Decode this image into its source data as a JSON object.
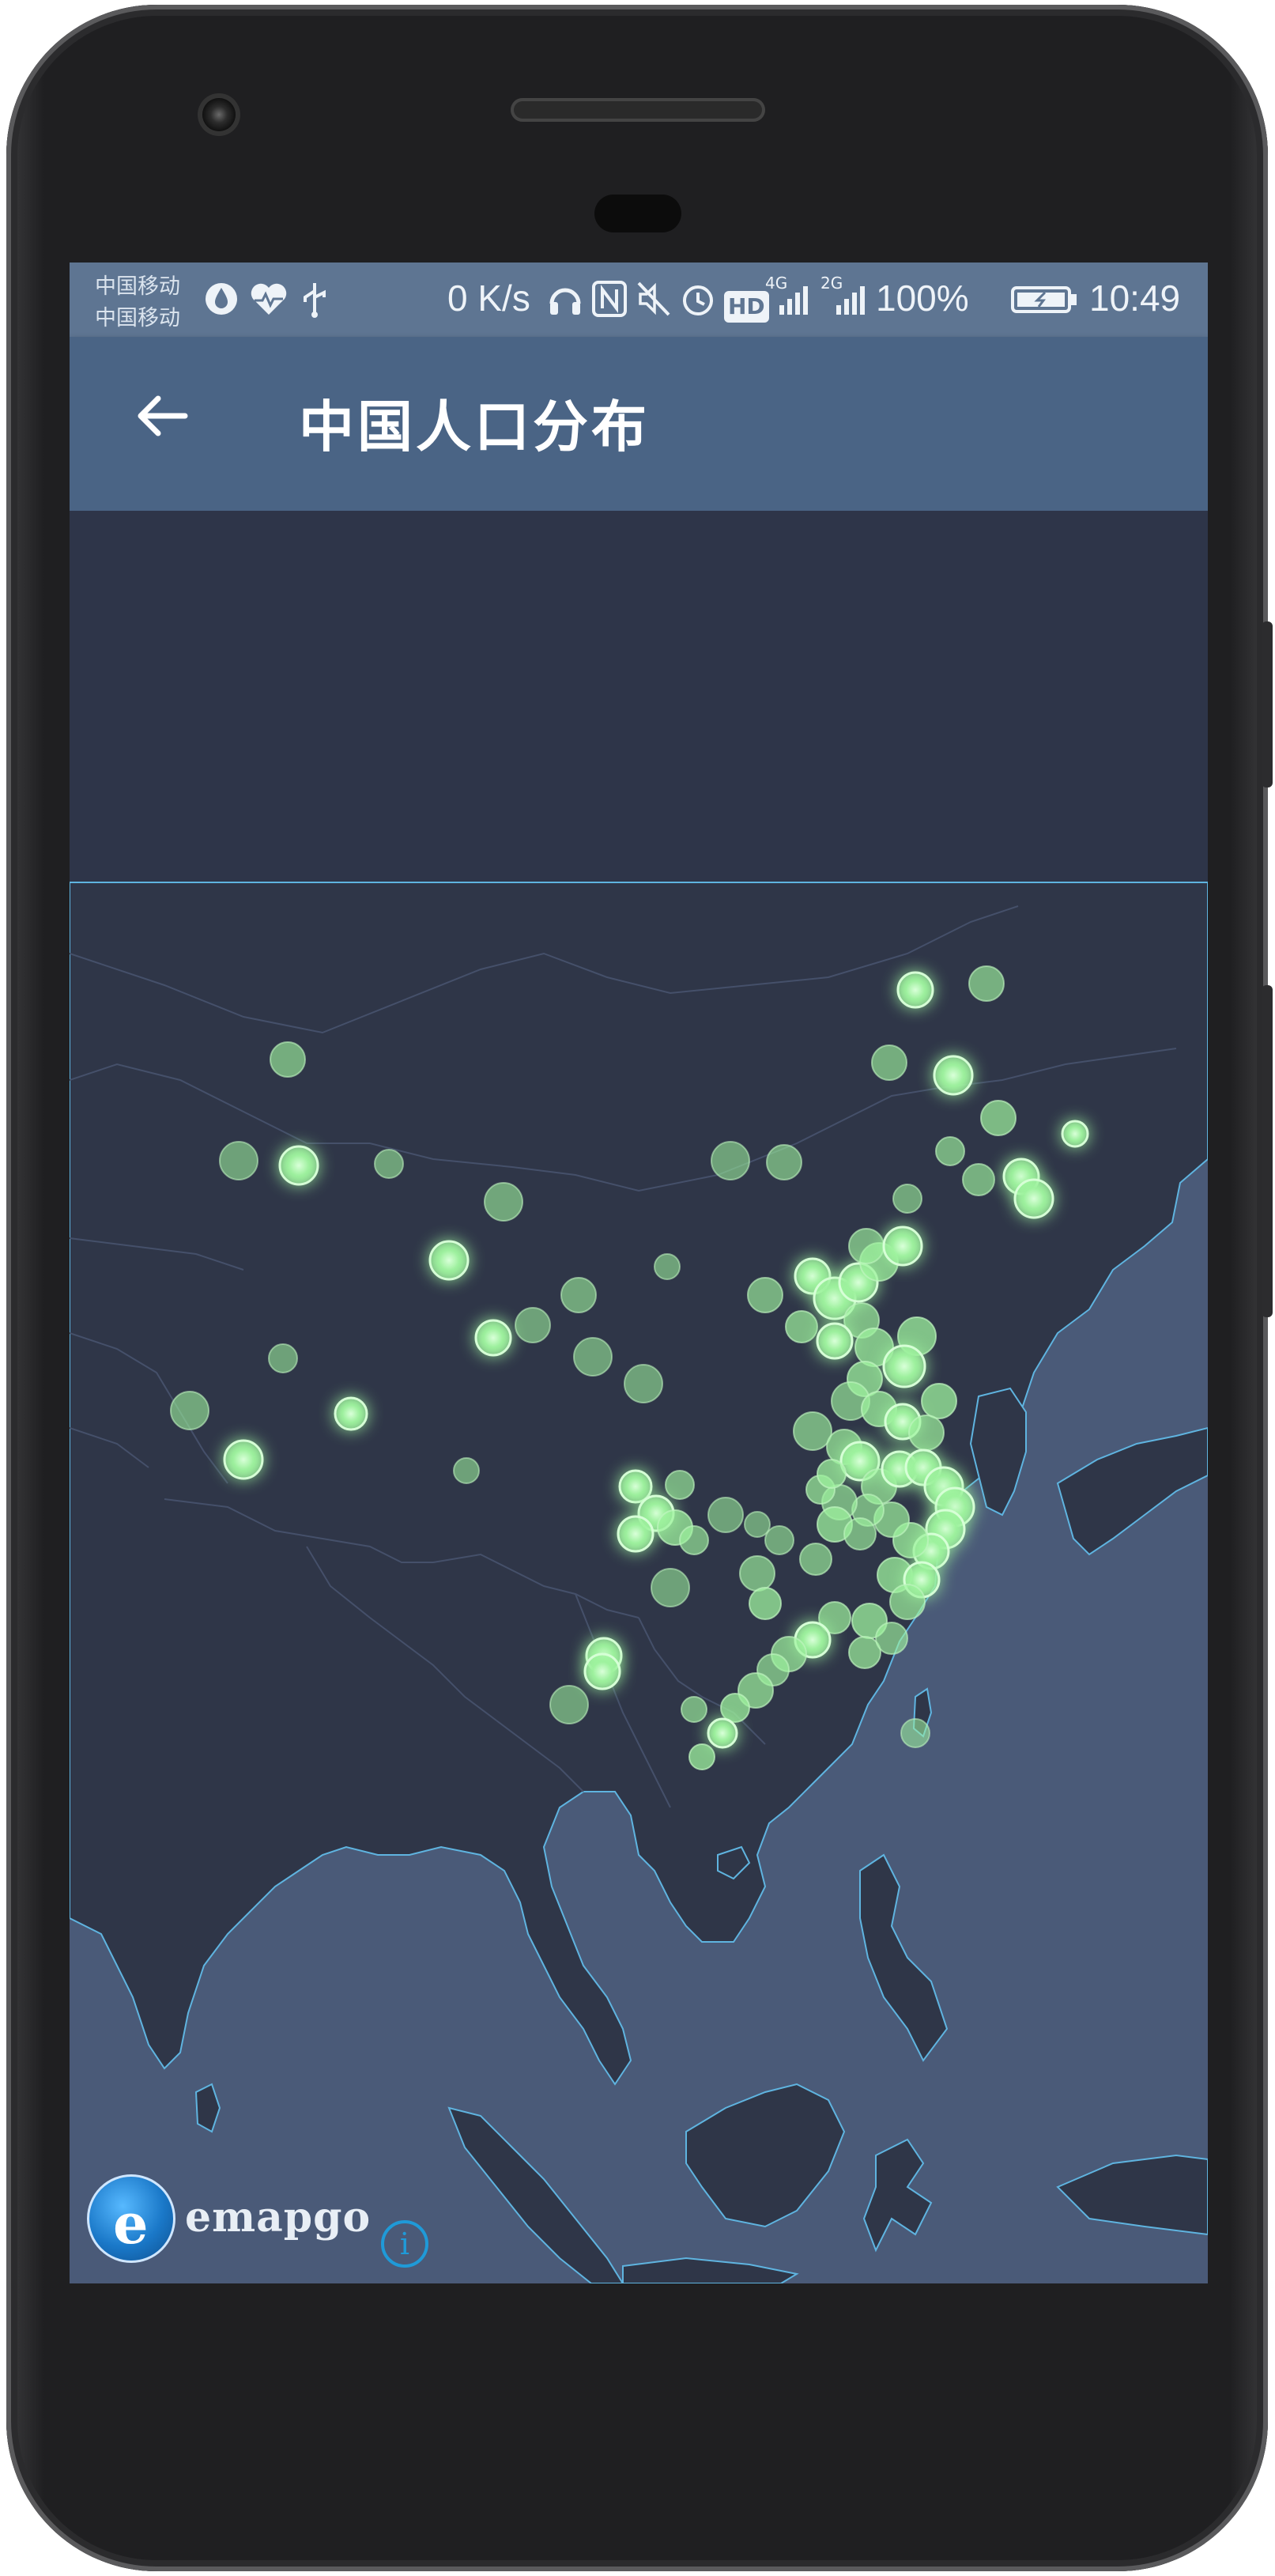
{
  "statusbar": {
    "carrier1": "中国移动",
    "carrier2": "中国移动",
    "net_speed": "0 K/s",
    "signal1_type": "4G",
    "signal2_type": "2G",
    "hd": "HD",
    "battery": "100%",
    "time": "10:49",
    "icons": [
      "water-drop-icon",
      "heartbeat-icon",
      "usb-icon",
      "headphone-icon",
      "nfc-icon",
      "mute-icon",
      "alarm-icon",
      "hd-icon",
      "signal-icon",
      "signal-icon",
      "battery-charging-icon"
    ]
  },
  "appbar": {
    "title": "中国人口分布",
    "back_icon": "arrow-left-icon"
  },
  "map": {
    "theme_colors": {
      "water": "#4a5a78",
      "land": "#2f3648",
      "border": "#44506a",
      "coast": "#5fb4e0",
      "point": "#9ef29e"
    },
    "point_count": 160
  },
  "footer": {
    "logo_text": "emapgo",
    "info_icon": "info-icon"
  }
}
